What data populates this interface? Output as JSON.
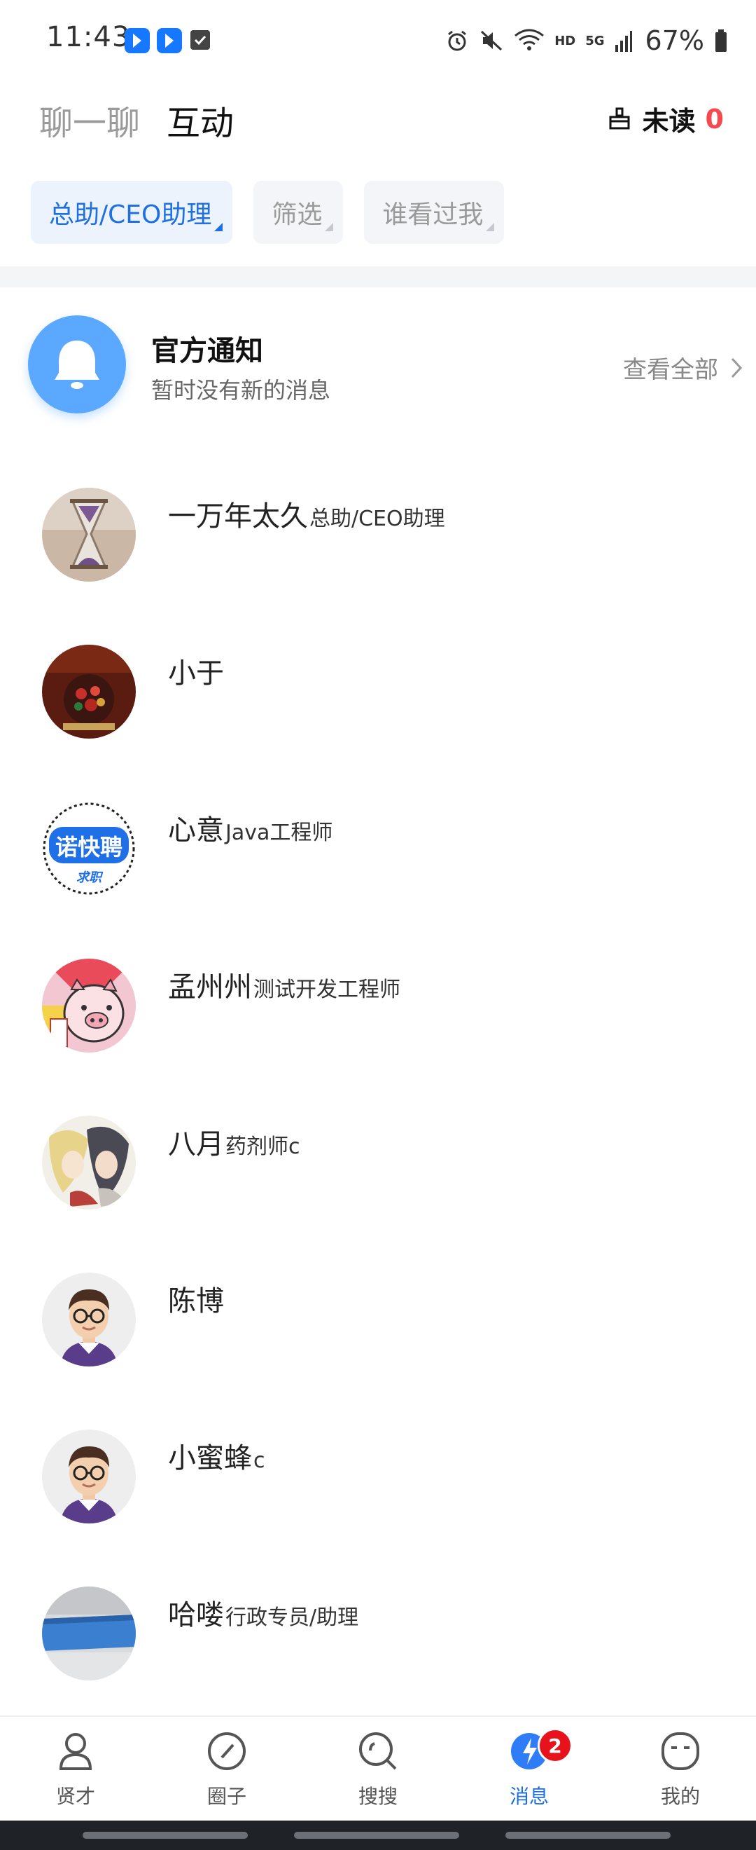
{
  "status_bar": {
    "time": "11:43",
    "network": "5G",
    "hd": "HD",
    "battery": "67%"
  },
  "header": {
    "tabs": [
      {
        "label": "聊一聊",
        "active": false
      },
      {
        "label": "互动",
        "active": true
      }
    ],
    "unread_label": "未读",
    "unread_count": "0"
  },
  "filters": [
    {
      "label": "总助/CEO助理",
      "active": true
    },
    {
      "label": "筛选",
      "active": false
    },
    {
      "label": "谁看过我",
      "active": false
    }
  ],
  "notice": {
    "title": "官方通知",
    "subtitle": "暂时没有新的消息",
    "view_all": "查看全部"
  },
  "contacts": [
    {
      "name": "一万年太久",
      "job": "总助/CEO助理",
      "avatar": "hourglass-photo"
    },
    {
      "name": "小于",
      "job": "",
      "avatar": "food-poster"
    },
    {
      "name": "心意",
      "job": "Java工程师",
      "avatar": "recruit-logo"
    },
    {
      "name": "孟州州",
      "job": "测试开发工程师",
      "avatar": "pig-cartoon"
    },
    {
      "name": "八月",
      "job": "药剂师c",
      "avatar": "anime-illustration"
    },
    {
      "name": "陈博",
      "job": "",
      "avatar": "glasses-man-cartoon"
    },
    {
      "name": "小蜜蜂",
      "job": "c",
      "avatar": "glasses-man-cartoon"
    },
    {
      "name": "哈喽",
      "job": "行政专员/助理",
      "avatar": "blue-stripe-photo"
    }
  ],
  "recruit_logo": {
    "text": "诺快聘",
    "tag": "求职"
  },
  "bottom_nav": [
    {
      "label": "贤才",
      "icon": "person-icon",
      "active": false
    },
    {
      "label": "圈子",
      "icon": "compass-icon",
      "active": false
    },
    {
      "label": "搜搜",
      "icon": "search-icon",
      "active": false
    },
    {
      "label": "消息",
      "icon": "message-bolt-icon",
      "active": true,
      "badge": "2"
    },
    {
      "label": "我的",
      "icon": "face-icon",
      "active": false
    }
  ],
  "colors": {
    "accent": "#1e6fe0",
    "unread_red": "#f5494f",
    "badge_red": "#e8121d",
    "notice_blue": "#5aa8ff"
  }
}
